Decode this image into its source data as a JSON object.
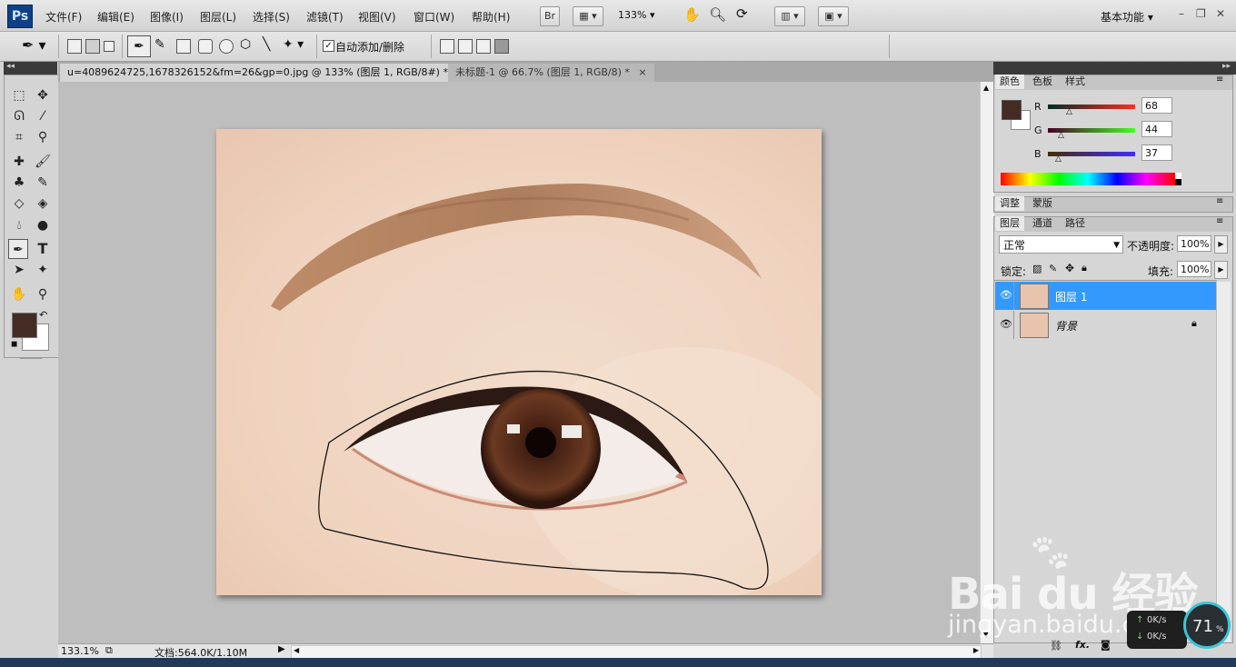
{
  "app": {
    "logo": "Ps"
  },
  "menu": [
    "文件(F)",
    "编辑(E)",
    "图像(I)",
    "图层(L)",
    "选择(S)",
    "滤镜(T)",
    "视图(V)",
    "窗口(W)",
    "帮助(H)"
  ],
  "menubar": {
    "bridge_label": "Br",
    "zoom": "133%",
    "workspace": "基本功能"
  },
  "options": {
    "auto_add_delete": "自动添加/删除",
    "auto_add_checked": true
  },
  "tabs": [
    {
      "label": "u=4089624725,1678326152&fm=26&gp=0.jpg @ 133% (图层 1, RGB/8#) *",
      "close": "×",
      "active": true
    },
    {
      "label": "未标题-1 @ 66.7% (图层 1, RGB/8) *",
      "close": "×",
      "active": false
    }
  ],
  "status": {
    "zoom": "133.1%",
    "doc": "文档:564.0K/1.10M"
  },
  "color_panel": {
    "tabs": [
      "颜色",
      "色板",
      "样式"
    ],
    "r_label": "R",
    "g_label": "G",
    "b_label": "B",
    "r": "68",
    "g": "44",
    "b": "37",
    "foreground": "#442c25",
    "background": "#ffffff"
  },
  "adjust_panel": {
    "tabs": [
      "调整",
      "蒙版"
    ]
  },
  "layers_panel": {
    "tabs": [
      "图层",
      "通道",
      "路径"
    ],
    "blend_mode": "正常",
    "opacity_label": "不透明度:",
    "opacity": "100%",
    "lock_label": "锁定:",
    "fill_label": "填充:",
    "fill": "100%",
    "layers": [
      {
        "name": "图层 1",
        "selected": true
      },
      {
        "name": "背景",
        "selected": false,
        "locked": true
      }
    ],
    "footer_fx": "fx."
  },
  "watermark": {
    "brand": "Bai du 经验",
    "url": "jingyan.baidu.com"
  },
  "net_widget": {
    "percent": "71",
    "unit": "%",
    "up": "0K/s",
    "down": "0K/s"
  },
  "colors": {
    "selected_layer": "#3399ff",
    "accent": "#0f3f86"
  }
}
